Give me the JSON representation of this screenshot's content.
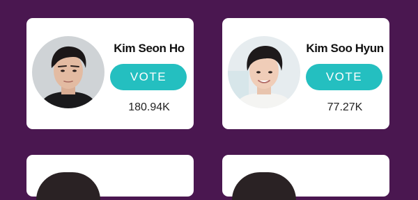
{
  "cards": [
    {
      "name": "Kim Seon Ho",
      "vote_label": "VOTE",
      "count": "180.94K"
    },
    {
      "name": "Kim Soo Hyun",
      "vote_label": "VOTE",
      "count": "77.27K"
    }
  ],
  "colors": {
    "background": "#4a1750",
    "card": "#ffffff",
    "vote_button": "#24bfc0"
  },
  "icons": {
    "avatar": "person-photo"
  }
}
